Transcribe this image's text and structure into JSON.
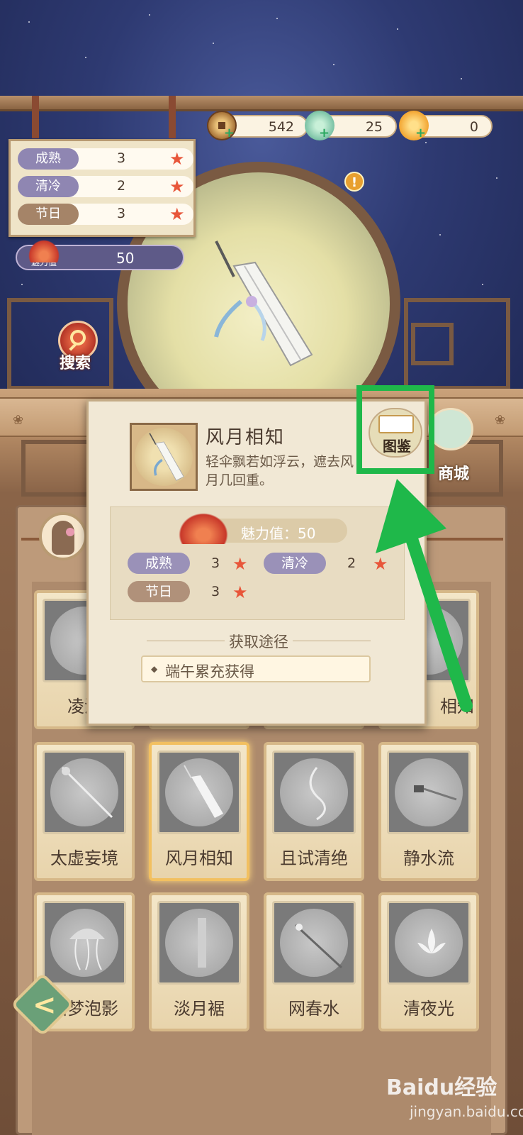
{
  "currency": [
    {
      "icon": "copper-coin-icon",
      "value": "542"
    },
    {
      "icon": "jade-icon",
      "value": "25"
    },
    {
      "icon": "gold-ingot-icon",
      "value": "0"
    }
  ],
  "attributes": [
    {
      "tag": "成熟",
      "value": "3"
    },
    {
      "tag": "清冷",
      "value": "2"
    },
    {
      "tag": "节日",
      "value": "3"
    }
  ],
  "charm": {
    "label": "魅力值",
    "value": "50"
  },
  "buttons": {
    "search": "搜索",
    "shop": "商城",
    "tujian": "图鉴"
  },
  "popup": {
    "name": "风月相知",
    "description": "轻伞飘若如浮云，遮去风月几回重。",
    "charm_label": "魅力值：50",
    "attributes": [
      {
        "tag": "成熟",
        "value": "3"
      },
      {
        "tag": "清冷",
        "value": "2"
      },
      {
        "tag": "节日",
        "value": "3"
      }
    ],
    "acquire_title": "获取途径",
    "acquire_item": "端午累充获得"
  },
  "grid": {
    "row1_visible": [
      "凌波",
      "相知"
    ],
    "items": [
      {
        "label": "太虚妄境"
      },
      {
        "label": "风月相知",
        "selected": true
      },
      {
        "label": "且试清绝"
      },
      {
        "label": "静水流"
      },
      {
        "label": "循梦泡影"
      },
      {
        "label": "淡月裾"
      },
      {
        "label": "网春水"
      },
      {
        "label": "清夜光"
      }
    ]
  },
  "watermark": {
    "main": "Baidu经验",
    "sub": "jingyan.baidu.com"
  },
  "colors": {
    "highlight": "#1fb84a",
    "accent_star": "#e8563a",
    "tag_purple": "#8f86b2",
    "tag_brown": "#a58468"
  }
}
